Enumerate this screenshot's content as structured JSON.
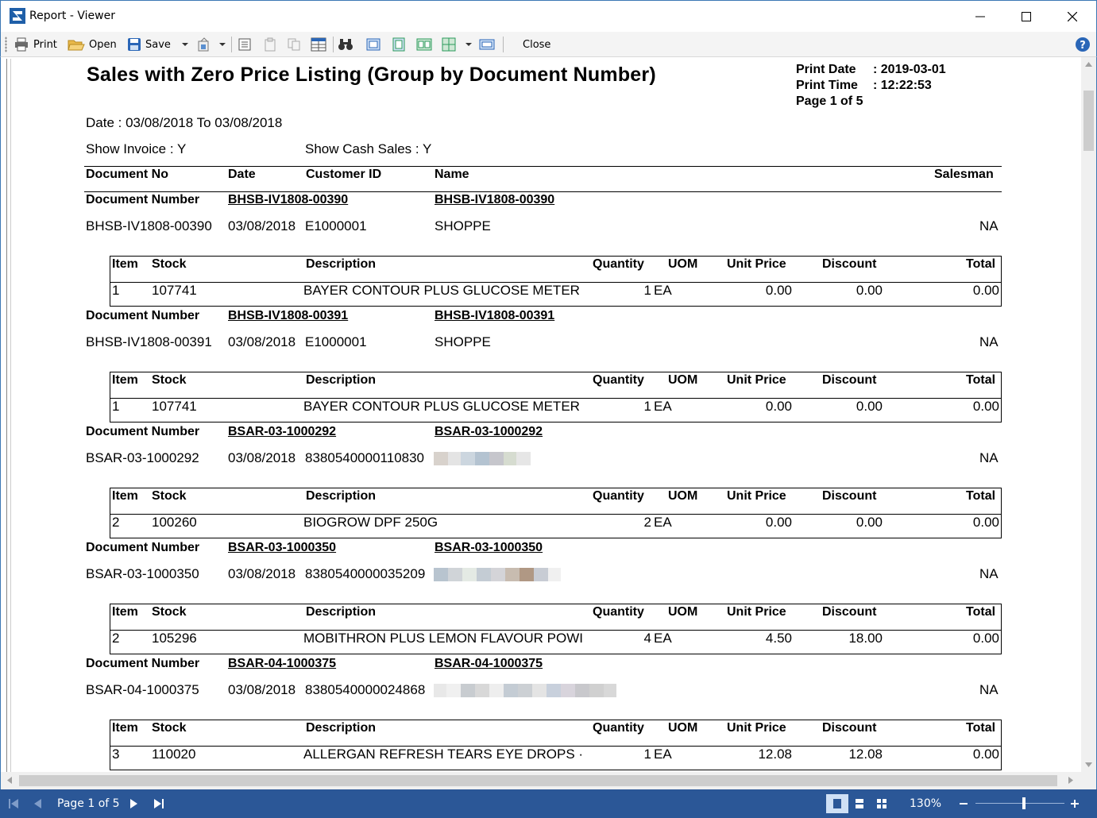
{
  "window": {
    "title": "Report - Viewer"
  },
  "toolbar": {
    "print_label": "Print",
    "open_label": "Open",
    "save_label": "Save",
    "close_label": "Close"
  },
  "report": {
    "title": "Sales with Zero Price Listing (Group by Document Number)",
    "print_date_label": "Print Date",
    "print_date_value": ": 2019-03-01",
    "print_time_label": "Print Time",
    "print_time_value": ": 12:22:53",
    "page_label": "Page 1 of 5",
    "date_range": "Date : 03/08/2018 To 03/08/2018",
    "show_invoice": "Show Invoice : Y",
    "show_cash_sales": "Show Cash Sales : Y",
    "columns": {
      "doc_no": "Document No",
      "date": "Date",
      "customer_id": "Customer ID",
      "name": "Name",
      "salesman": "Salesman"
    },
    "item_columns": {
      "item": "Item",
      "stock": "Stock",
      "description": "Description",
      "quantity": "Quantity",
      "uom": "UOM",
      "unit_price": "Unit Price",
      "discount": "Discount",
      "total": "Total"
    },
    "group_label": "Document Number",
    "groups": [
      {
        "doc_number": "BHSB-IV1808-00390",
        "doc_number2": "BHSB-IV1808-00390",
        "doc_no": "BHSB-IV1808-00390",
        "date": "03/08/2018",
        "customer_id": "E1000001",
        "name": "SHOPPE",
        "salesman": "NA",
        "item": {
          "no": "1",
          "stock": "107741",
          "description": "BAYER CONTOUR PLUS GLUCOSE METER",
          "qty": "1",
          "uom": "EA",
          "unit_price": "0.00",
          "discount": "0.00",
          "total": "0.00"
        }
      },
      {
        "doc_number": "BHSB-IV1808-00391",
        "doc_number2": "BHSB-IV1808-00391",
        "doc_no": "BHSB-IV1808-00391",
        "date": "03/08/2018",
        "customer_id": "E1000001",
        "name": "SHOPPE",
        "salesman": "NA",
        "item": {
          "no": "1",
          "stock": "107741",
          "description": "BAYER CONTOUR PLUS GLUCOSE METER",
          "qty": "1",
          "uom": "EA",
          "unit_price": "0.00",
          "discount": "0.00",
          "total": "0.00"
        }
      },
      {
        "doc_number": "BSAR-03-1000292",
        "doc_number2": "BSAR-03-1000292",
        "doc_no": "BSAR-03-1000292",
        "date": "03/08/2018",
        "customer_id": "8380540000110830",
        "name": "",
        "salesman": "NA",
        "item": {
          "no": "2",
          "stock": "100260",
          "description": "BIOGROW DPF 250G",
          "qty": "2",
          "uom": "EA",
          "unit_price": "0.00",
          "discount": "0.00",
          "total": "0.00"
        }
      },
      {
        "doc_number": "BSAR-03-1000350",
        "doc_number2": "BSAR-03-1000350",
        "doc_no": "BSAR-03-1000350",
        "date": "03/08/2018",
        "customer_id": "8380540000035209",
        "name": "",
        "salesman": "NA",
        "item": {
          "no": "2",
          "stock": "105296",
          "description": "MOBITHRON PLUS LEMON FLAVOUR POWI",
          "qty": "4",
          "uom": "EA",
          "unit_price": "4.50",
          "discount": "18.00",
          "total": "0.00"
        }
      },
      {
        "doc_number": "BSAR-04-1000375",
        "doc_number2": "BSAR-04-1000375",
        "doc_no": "BSAR-04-1000375",
        "date": "03/08/2018",
        "customer_id": "8380540000024868",
        "name": "",
        "salesman": "NA",
        "item": {
          "no": "3",
          "stock": "110020",
          "description": "ALLERGAN REFRESH TEARS EYE DROPS ·",
          "qty": "1",
          "uom": "EA",
          "unit_price": "12.08",
          "discount": "12.08",
          "total": "0.00"
        }
      }
    ]
  },
  "statusbar": {
    "page_indicator": "Page 1 of 5",
    "zoom": "130%"
  },
  "colors": {
    "statusbar": "#2b5797",
    "window_border": "#3c78b4"
  },
  "icons": [
    "app-logo-icon",
    "minimize-icon",
    "maximize-icon",
    "close-icon",
    "printer-icon",
    "folder-open-icon",
    "floppy-icon",
    "help-icon",
    "binoculars-icon",
    "first-page-icon",
    "previous-page-icon",
    "next-page-icon",
    "last-page-icon"
  ]
}
